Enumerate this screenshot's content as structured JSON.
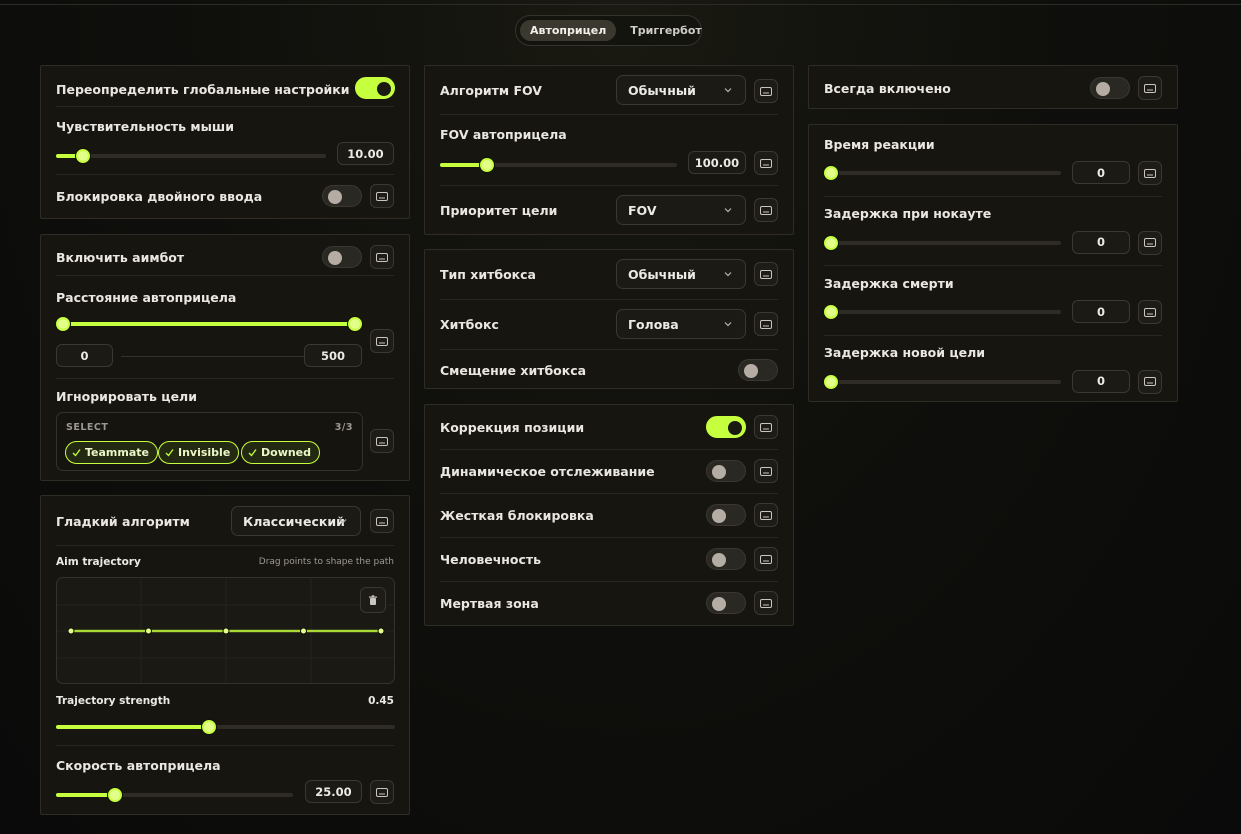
{
  "tabs": [
    "Автоприцел",
    "Триггербот"
  ],
  "active_tab": 0,
  "colors": {
    "accent": "#c6ff3d",
    "card": "#17150f",
    "border": "#2e2c25"
  },
  "col1": {
    "override": {
      "label": "Переопределить глобальные настройки",
      "on": true
    },
    "sensitivity": {
      "label": "Чувствительность мыши",
      "value": "10.00",
      "fraction": 0.1
    },
    "double_input": {
      "label": "Блокировка двойного ввода",
      "on": false
    },
    "enable_aimbot": {
      "label": "Включить аимбот",
      "on": false
    },
    "distance": {
      "label": "Расстояние автоприцела",
      "min": "0",
      "max": "500",
      "low_fraction": 0.0,
      "high_fraction": 1.0
    },
    "ignore": {
      "label": "Игнорировать цели",
      "select_label": "SELECT",
      "count": "3/3",
      "chips": [
        "Teammate",
        "Invisible",
        "Downed"
      ]
    },
    "smooth": {
      "label": "Гладкий алгоритм",
      "value": "Классический"
    },
    "trajectory": {
      "title": "Aim trajectory",
      "hint": "Drag points to shape the path",
      "points": [
        0,
        0.25,
        0.5,
        0.75,
        1
      ]
    },
    "strength": {
      "label": "Trajectory strength",
      "value": "0.45",
      "fraction": 0.45
    },
    "speed": {
      "label": "Скорость автоприцела",
      "value": "25.00",
      "fraction": 0.25
    }
  },
  "col2": {
    "fov_algo": {
      "label": "Алгоритм FOV",
      "value": "Обычный"
    },
    "fov": {
      "label": "FOV автоприцела",
      "value": "100.00",
      "fraction": 0.2
    },
    "priority": {
      "label": "Приоритет цели",
      "value": "FOV"
    },
    "hitbox_type": {
      "label": "Тип хитбокса",
      "value": "Обычный"
    },
    "hitbox": {
      "label": "Хитбокс",
      "value": "Голова"
    },
    "hitbox_offset": {
      "label": "Смещение хитбокса",
      "on": false
    },
    "toggles": [
      {
        "label": "Коррекция позиции",
        "on": true
      },
      {
        "label": "Динамическое отслеживание",
        "on": false
      },
      {
        "label": "Жесткая блокировка",
        "on": false
      },
      {
        "label": "Человечность",
        "on": false
      },
      {
        "label": "Мертвая зона",
        "on": false
      }
    ]
  },
  "col3": {
    "always_on": {
      "label": "Всегда включено",
      "on": false
    },
    "delays": [
      {
        "label": "Время реакции",
        "value": "0",
        "fraction": 0
      },
      {
        "label": "Задержка при нокауте",
        "value": "0",
        "fraction": 0
      },
      {
        "label": "Задержка смерти",
        "value": "0",
        "fraction": 0
      },
      {
        "label": "Задержка новой цели",
        "value": "0",
        "fraction": 0
      }
    ]
  }
}
